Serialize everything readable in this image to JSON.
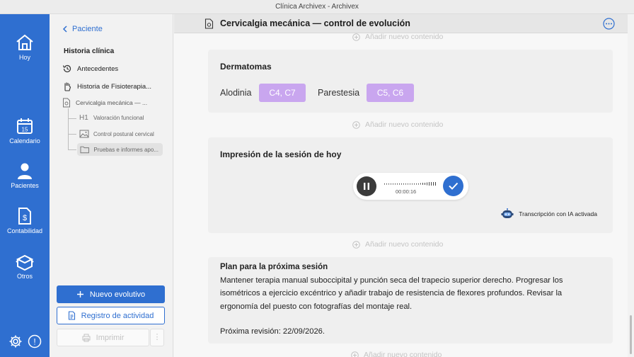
{
  "window": {
    "title": "Clínica Archivex - Archivex"
  },
  "rail": {
    "items": [
      {
        "label": "Hoy",
        "icon": "home-icon"
      },
      {
        "label": "Calendario",
        "icon": "calendar-icon",
        "day": "15"
      },
      {
        "label": "Pacientes",
        "icon": "person-icon"
      },
      {
        "label": "Contabilidad",
        "icon": "invoice-icon"
      },
      {
        "label": "Otros",
        "icon": "box-icon"
      }
    ],
    "alert_symbol": "!"
  },
  "sidebar": {
    "back_label": "Paciente",
    "section_title": "Historia clínica",
    "items": [
      {
        "label": "Antecedentes",
        "icon": "history-icon"
      },
      {
        "label": "Historia de Fisioterapia...",
        "icon": "hand-icon"
      },
      {
        "label": "Cervicalgia mecánica — ...",
        "icon": "document-icon"
      }
    ],
    "subitems": [
      {
        "label": "Valoración funcional",
        "icon": "heading-icon",
        "badge": "H1"
      },
      {
        "label": "Control postural cervical",
        "icon": "image-icon"
      },
      {
        "label": "Pruebas e informes apo...",
        "icon": "folder-icon"
      }
    ],
    "buttons": {
      "new": "Nuevo evolutivo",
      "log": "Registro de actividad",
      "print": "Imprimir",
      "more": "⋮"
    }
  },
  "header": {
    "title": "Cervicalgia mecánica — control de evolución"
  },
  "content": {
    "add_label": "Añadir nuevo contenido",
    "dermatomas": {
      "title": "Dermatomas",
      "groups": [
        {
          "label": "Alodinia",
          "value": "C4, C7"
        },
        {
          "label": "Parestesia",
          "value": "C5, C6"
        }
      ]
    },
    "impresion": {
      "title": "Impresión de la sesión de hoy",
      "recording_time": "00:00:16",
      "ia_label": "Transcripción con IA activada"
    },
    "plan": {
      "title": "Plan para la próxima sesión",
      "text": "Mantener terapia manual suboccipital y punción seca del trapecio superior derecho. Progresar los isométricos a ejercicio excéntrico y añadir trabajo de resistencia de flexores profundos. Revisar la ergonomía del puesto con fotografías del montaje real.",
      "next_review": "Próxima revisión: 22/09/2026."
    }
  },
  "colors": {
    "accent": "#2f6fd0",
    "chip": "#c9a6ef",
    "card": "#efefef"
  }
}
